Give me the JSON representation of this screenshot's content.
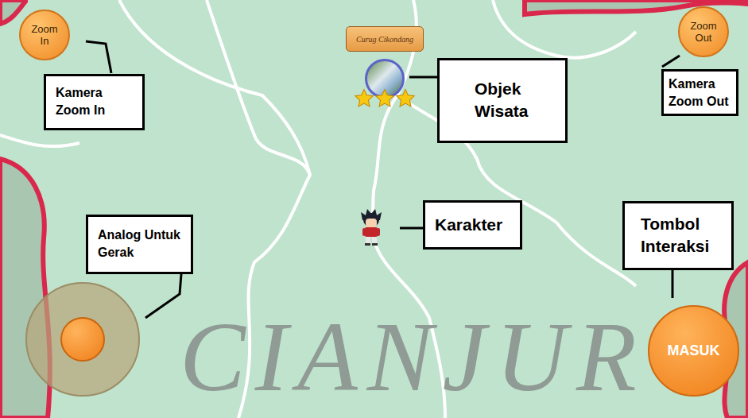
{
  "map": {
    "watermark": "CIANJUR"
  },
  "buttons": {
    "zoom_in": "Zoom In",
    "zoom_out": "Zoom Out",
    "interact": "MASUK"
  },
  "tourist_spot": {
    "name": "Curug Cikondang",
    "stars": 3
  },
  "annotations": [
    {
      "id": "zoom-in",
      "label": "Kamera Zoom In"
    },
    {
      "id": "zoom-out",
      "label": "Kamera Zoom Out"
    },
    {
      "id": "spot",
      "label": "Objek Wisata"
    },
    {
      "id": "character",
      "label": "Karakter"
    },
    {
      "id": "joystick",
      "label": "Analog Untuk Gerak"
    },
    {
      "id": "interact",
      "label": "Tombol Interaksi"
    }
  ]
}
